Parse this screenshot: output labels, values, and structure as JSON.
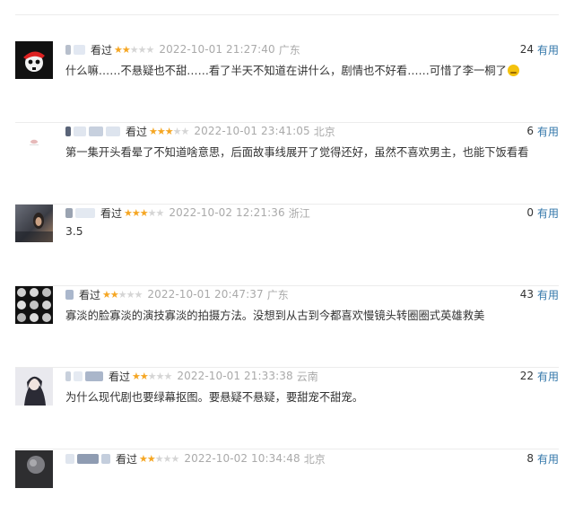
{
  "comments": [
    {
      "status": "看过",
      "rating": 2,
      "time": "2022-10-01 21:27:40",
      "location": "广东",
      "votes": "24",
      "useful_label": "有用",
      "content": "什么嘛……不悬疑也不甜……看了半天不知道在讲什么，剧情也不好看……可惜了李一桐了"
    },
    {
      "status": "看过",
      "rating": 3,
      "time": "2022-10-01 23:41:05",
      "location": "北京",
      "votes": "6",
      "useful_label": "有用",
      "content": "第一集开头看晕了不知道啥意思，后面故事线展开了觉得还好，虽然不喜欢男主，也能下饭看看"
    },
    {
      "status": "看过",
      "rating": 3,
      "time": "2022-10-02 12:21:36",
      "location": "浙江",
      "votes": "0",
      "useful_label": "有用",
      "content": "3.5"
    },
    {
      "status": "看过",
      "rating": 2,
      "time": "2022-10-01 20:47:37",
      "location": "广东",
      "votes": "43",
      "useful_label": "有用",
      "content": "寡淡的脸寡淡的演技寡淡的拍摄方法。没想到从古到今都喜欢慢镜头转圈圈式英雄救美"
    },
    {
      "status": "看过",
      "rating": 2,
      "time": "2022-10-01 21:33:38",
      "location": "云南",
      "votes": "22",
      "useful_label": "有用",
      "content": "为什么现代剧也要绿幕抠图。要悬疑不悬疑，要甜宠不甜宠。"
    },
    {
      "status": "看过",
      "rating": 2,
      "time": "2022-10-02 10:34:48",
      "location": "北京",
      "votes": "8",
      "useful_label": "有用",
      "content": ""
    }
  ],
  "colors": {
    "star_on": "#f5a623",
    "star_off": "#d5d5d5",
    "useful_link": "#3377aa",
    "muted": "#aaaaaa"
  }
}
